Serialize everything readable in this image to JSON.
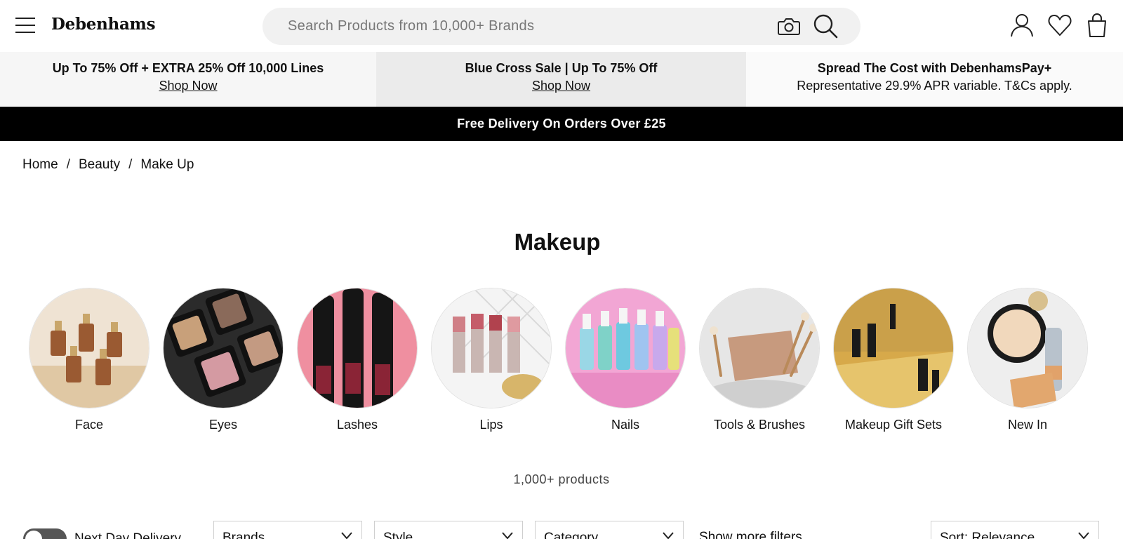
{
  "header": {
    "logo": "Debenhams",
    "search_placeholder": "Search Products from 10,000+ Brands",
    "icons": [
      "menu-icon",
      "camera-icon",
      "search-icon",
      "account-icon",
      "wishlist-heart-icon",
      "shopping-bag-icon"
    ]
  },
  "promos": [
    {
      "title": "Up To 75% Off + EXTRA 25% Off 10,000 Lines",
      "link": "Shop Now"
    },
    {
      "title": "Blue Cross Sale | Up To 75% Off",
      "link": "Shop Now"
    },
    {
      "title": "Spread The Cost with DebenhamsPay+",
      "subtitle": "Representative 29.9% APR variable. T&Cs apply."
    }
  ],
  "delivery_bar": "Free Delivery On Orders Over £25",
  "breadcrumb": [
    "Home",
    "Beauty",
    "Make Up"
  ],
  "page_title": "Makeup",
  "categories": [
    {
      "label": "Face"
    },
    {
      "label": "Eyes"
    },
    {
      "label": "Lashes"
    },
    {
      "label": "Lips"
    },
    {
      "label": "Nails"
    },
    {
      "label": "Tools & Brushes"
    },
    {
      "label": "Makeup Gift Sets"
    },
    {
      "label": "New In"
    }
  ],
  "product_count": "1,000+ products",
  "filters": {
    "next_day_label": "Next Day Delivery",
    "brands": "Brands",
    "style": "Style",
    "category": "Category",
    "more": "Show more filters",
    "sort": "Sort: Relevance"
  },
  "colors": {
    "accent": "#000000",
    "promo_bg": "#f6f6f6",
    "search_bg": "#f1f1f1"
  }
}
